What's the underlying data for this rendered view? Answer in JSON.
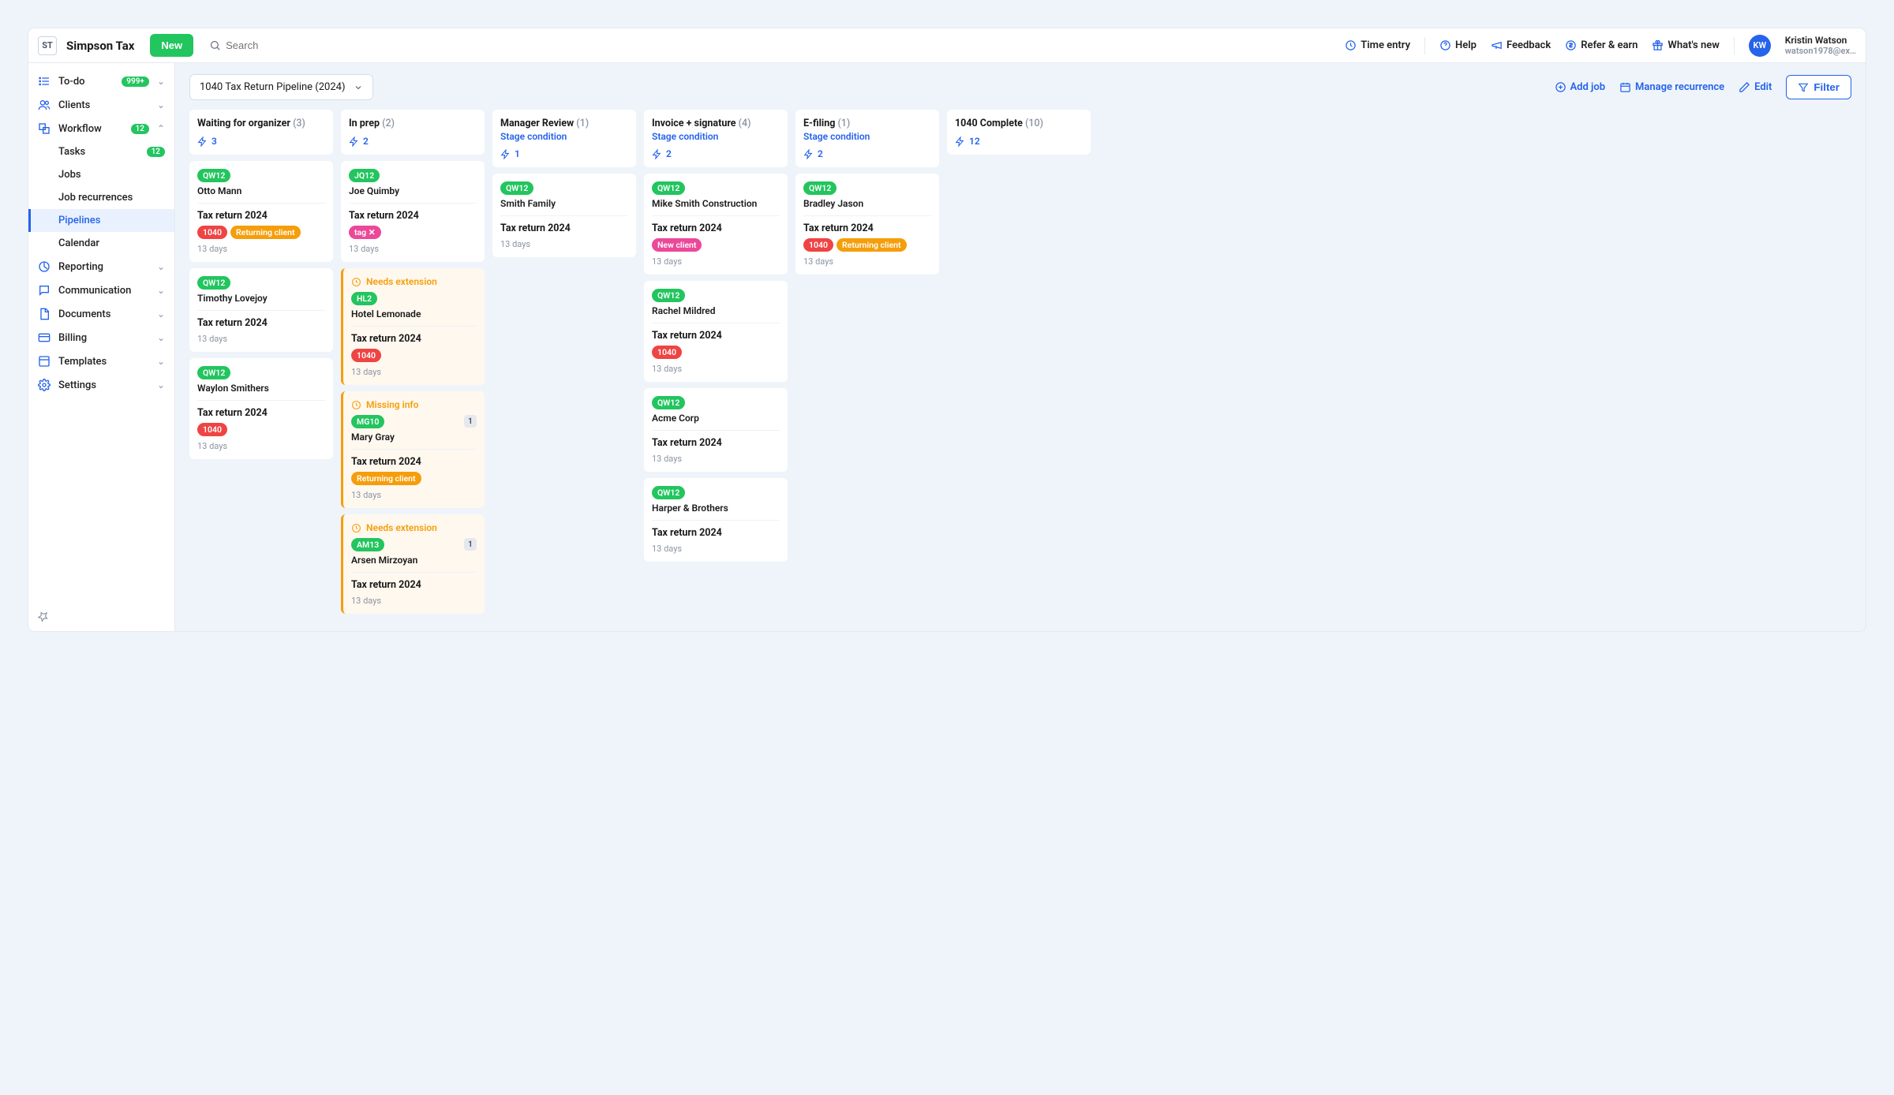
{
  "company": {
    "initials": "ST",
    "name": "Simpson Tax"
  },
  "topbar": {
    "new_label": "New",
    "search_placeholder": "Search",
    "links": {
      "time_entry": "Time entry",
      "help": "Help",
      "feedback": "Feedback",
      "refer": "Refer & earn",
      "whats_new": "What's new"
    },
    "user": {
      "initials": "KW",
      "name": "Kristin Watson",
      "email": "watson1978@ex…"
    }
  },
  "sidebar": {
    "todo": {
      "label": "To-do",
      "badge": "999+"
    },
    "clients": "Clients",
    "workflow": {
      "label": "Workflow",
      "badge": "12"
    },
    "workflow_children": {
      "tasks": {
        "label": "Tasks",
        "badge": "12"
      },
      "jobs": "Jobs",
      "job_recurrences": "Job recurrences",
      "pipelines": "Pipelines",
      "calendar": "Calendar"
    },
    "reporting": "Reporting",
    "communication": "Communication",
    "documents": "Documents",
    "billing": "Billing",
    "templates": "Templates",
    "settings": "Settings"
  },
  "toolbar": {
    "dropdown": "1040 Tax Return Pipeline (2024)",
    "add_job": "Add job",
    "manage": "Manage recurrence",
    "edit": "Edit",
    "filter": "Filter"
  },
  "stage_condition_label": "Stage condition",
  "columns": [
    {
      "id": "waiting",
      "title": "Waiting for organizer",
      "count": "(3)",
      "auto": "3",
      "cards": [
        {
          "code": "QW12",
          "client": "Otto Mann",
          "job": "Tax return 2024",
          "tags": [
            {
              "text": "1040",
              "cls": "tag-red"
            },
            {
              "text": "Returning client",
              "cls": "tag-orange"
            }
          ],
          "days": "13 days"
        },
        {
          "code": "QW12",
          "client": "Timothy Lovejoy",
          "job": "Tax return 2024",
          "days": "13 days"
        },
        {
          "code": "QW12",
          "client": "Waylon Smithers",
          "job": "Tax return 2024",
          "tags": [
            {
              "text": "1040",
              "cls": "tag-red"
            }
          ],
          "days": "13 days"
        }
      ]
    },
    {
      "id": "inprep",
      "title": "In prep",
      "count": "(2)",
      "auto": "2",
      "cards": [
        {
          "code": "JQ12",
          "client": "Joe Quimby",
          "job": "Tax return 2024",
          "tags": [
            {
              "text": "tag",
              "cls": "tag-pink",
              "x": true
            }
          ],
          "days": "13 days"
        },
        {
          "alert": "Needs extension",
          "code": "HL2",
          "client": "Hotel Lemonade",
          "job": "Tax return 2024",
          "tags": [
            {
              "text": "1040",
              "cls": "tag-red"
            }
          ],
          "days": "13 days"
        },
        {
          "alert": "Missing info",
          "code": "MG10",
          "client": "Mary Gray",
          "badge": "1",
          "job": "Tax return 2024",
          "tags": [
            {
              "text": "Returning client",
              "cls": "tag-orange"
            }
          ],
          "days": "13 days"
        },
        {
          "alert": "Needs extension",
          "code": "AM13",
          "client": "Arsen Mirzoyan",
          "badge": "1",
          "job": "Tax return 2024",
          "days": "13 days"
        }
      ]
    },
    {
      "id": "manager",
      "title": "Manager Review",
      "count": "(1)",
      "stage_condition": true,
      "auto": "1",
      "cards": [
        {
          "code": "QW12",
          "client": "Smith Family",
          "job": "Tax return 2024",
          "days": "13 days"
        }
      ]
    },
    {
      "id": "invoice",
      "title": "Invoice + signature",
      "count": "(4)",
      "stage_condition": true,
      "auto": "2",
      "cards": [
        {
          "code": "QW12",
          "client": "Mike Smith Construction",
          "job": "Tax return 2024",
          "tags": [
            {
              "text": "New client",
              "cls": "tag-pink"
            }
          ],
          "days": "13 days"
        },
        {
          "code": "QW12",
          "client": "Rachel Mildred",
          "job": "Tax return 2024",
          "tags": [
            {
              "text": "1040",
              "cls": "tag-red"
            }
          ],
          "days": "13 days"
        },
        {
          "code": "QW12",
          "client": "Acme Corp",
          "job": "Tax return 2024",
          "days": "13 days"
        },
        {
          "code": "QW12",
          "client": "Harper & Brothers",
          "job": "Tax return 2024",
          "days": "13 days"
        }
      ]
    },
    {
      "id": "efiling",
      "title": "E-filing",
      "count": "(1)",
      "stage_condition": true,
      "auto": "2",
      "cards": [
        {
          "code": "QW12",
          "client": "Bradley Jason",
          "job": "Tax return 2024",
          "tags": [
            {
              "text": "1040",
              "cls": "tag-red"
            },
            {
              "text": "Returning client",
              "cls": "tag-orange"
            }
          ],
          "days": "13 days"
        }
      ]
    },
    {
      "id": "complete",
      "title": "1040 Complete",
      "count": "(10)",
      "auto": "12",
      "cards": []
    }
  ]
}
